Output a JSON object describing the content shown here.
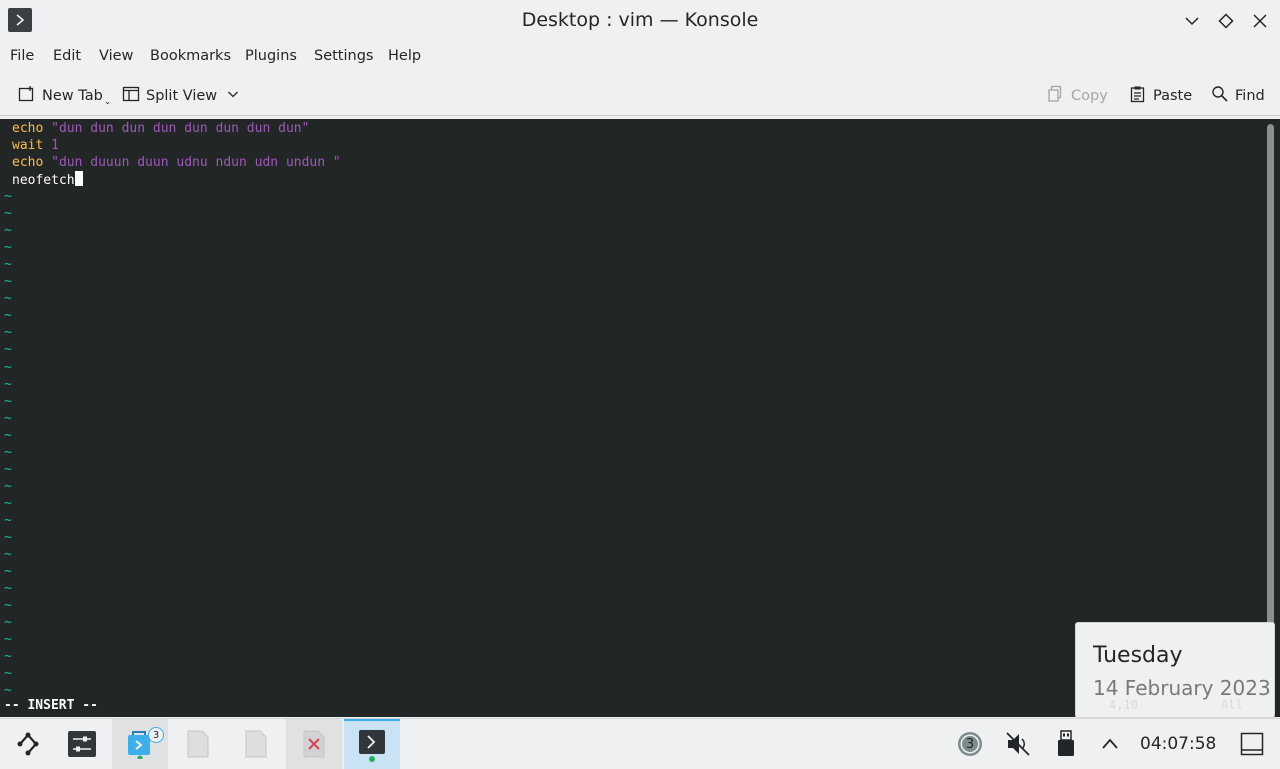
{
  "window": {
    "title": "Desktop : vim — Konsole"
  },
  "menu": [
    "File",
    "Edit",
    "View",
    "Bookmarks",
    "Plugins",
    "Settings",
    "Help"
  ],
  "toolbar": {
    "new_tab": "New Tab",
    "split_view": "Split View",
    "copy": "Copy",
    "paste": "Paste",
    "find": "Find"
  },
  "terminal": {
    "line1_kw": "echo",
    "line1_str": " \"dun dun dun dun dun dun dun dun\"",
    "line2_kw": "wait",
    "line2_str": " 1",
    "line3_kw": "echo",
    "line3_str": " \"dun duuun duun udnu ndun udn undun \"",
    "line4": "neofetch",
    "tilde": "~",
    "mode": "-- INSERT --"
  },
  "date_popup": {
    "day": "Tuesday",
    "date": "14 February 2023",
    "ghost_pos": "4,10",
    "ghost_scroll": "All"
  },
  "taskbar": {
    "notification_count": "3",
    "badge": "3",
    "time": "04:07:58"
  },
  "colors": {
    "terminal_bg": "#232627",
    "keyword": "#fdbc4b",
    "string": "#9b59b6",
    "tilde": "#1abc9c",
    "accent": "#3daee9"
  }
}
